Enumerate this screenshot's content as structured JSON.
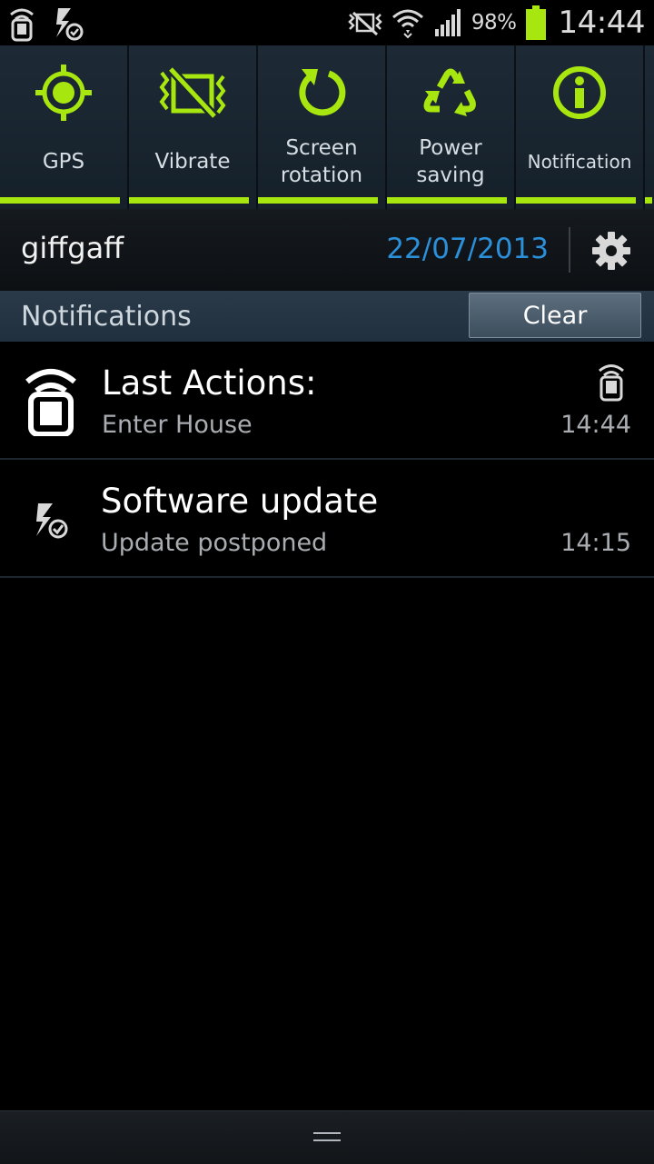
{
  "status_bar": {
    "left_icons": [
      "smartphone-remote-icon",
      "software-update-icon"
    ],
    "right_icons": [
      "vibrate-mode-icon",
      "wifi-icon",
      "signal-icon",
      "battery-icon"
    ],
    "battery_percent": "98%",
    "time": "14:44",
    "battery_level": 0.98
  },
  "quick_settings": {
    "accent_color": "#a8e60f",
    "toggles": [
      {
        "label": "GPS",
        "icon": "gps-icon",
        "active": true
      },
      {
        "label": "Vibrate",
        "icon": "vibrate-icon",
        "active": true
      },
      {
        "label": "Screen\nrotation",
        "icon": "rotation-icon",
        "active": true
      },
      {
        "label": "Power\nsaving",
        "icon": "recycle-icon",
        "active": true
      },
      {
        "label": "Notification",
        "icon": "info-icon",
        "active": true
      }
    ]
  },
  "info_row": {
    "carrier": "giffgaff",
    "date": "22/07/2013",
    "date_color": "#2b8fd9",
    "settings_icon": "gear-icon"
  },
  "notifications_header": {
    "title": "Notifications",
    "clear_label": "Clear"
  },
  "notifications": [
    {
      "title": "Last Actions:",
      "subtitle": "Enter House",
      "time": "14:44",
      "icon": "smartphone-remote-icon"
    },
    {
      "title": "Software update",
      "subtitle": "Update postponed",
      "time": "14:15",
      "icon": "software-update-icon"
    }
  ],
  "handle": {
    "icon": "drag-handle-icon"
  }
}
